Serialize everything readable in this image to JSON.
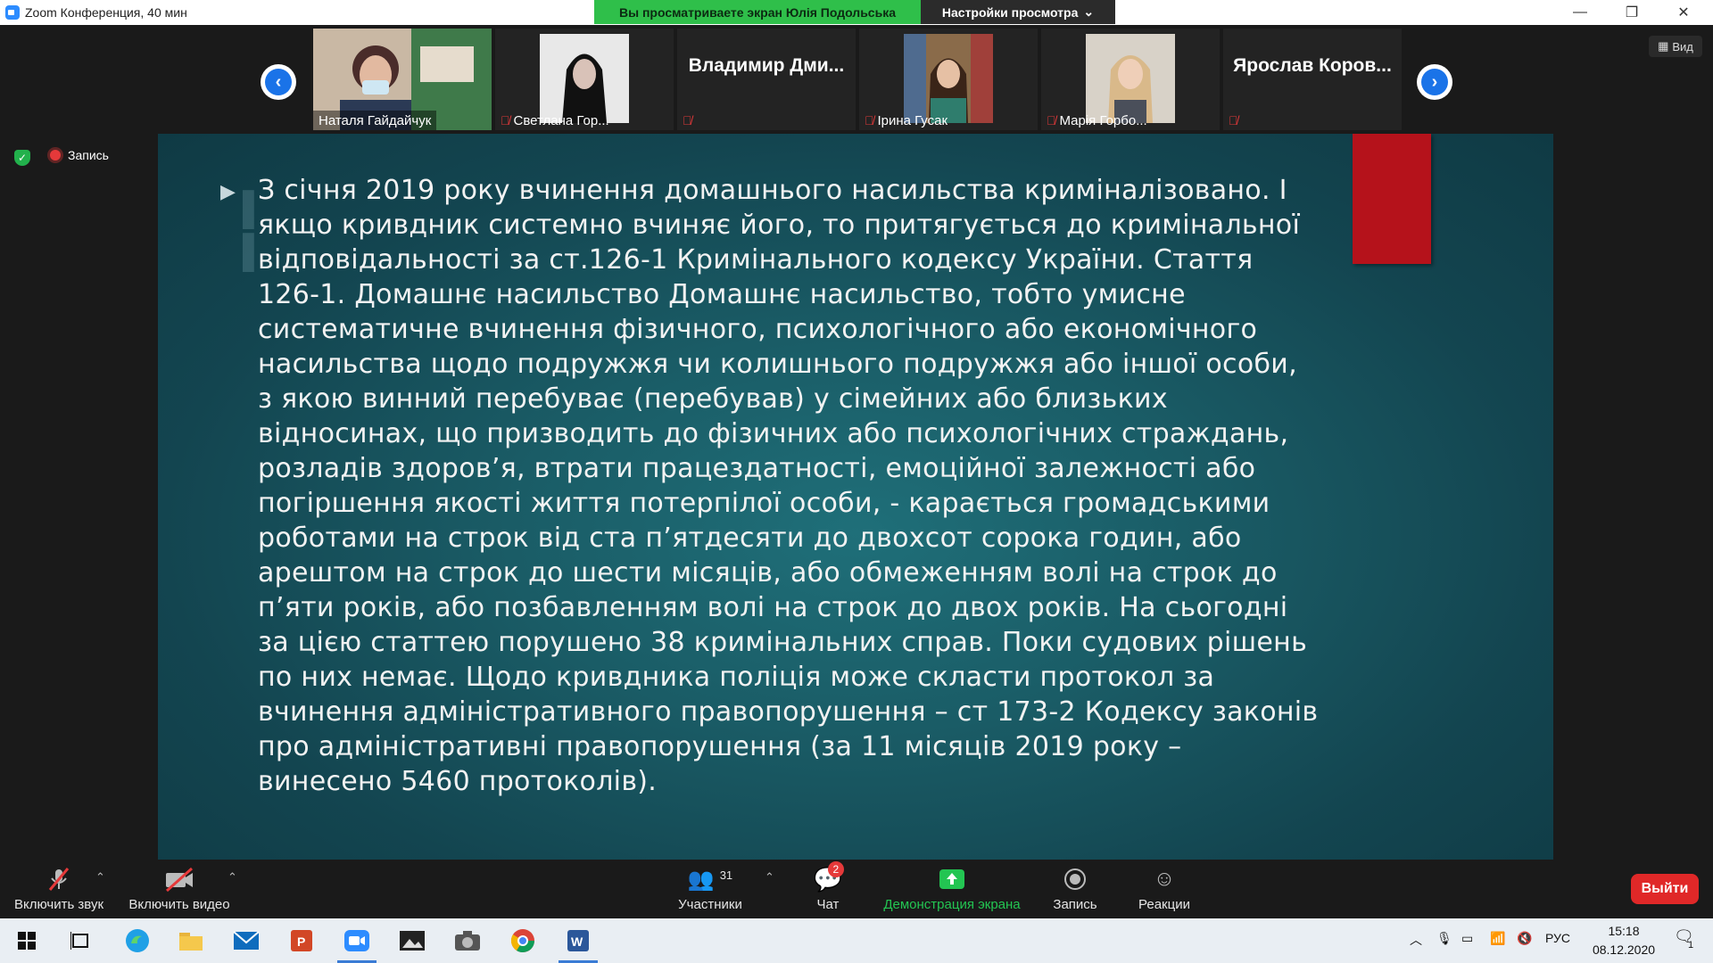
{
  "window": {
    "title": "Zoom Конференция, 40 мин",
    "share_banner": "Вы просматриваете экран Юлія Подольська",
    "view_settings": "Настройки просмотра",
    "minimize": "—",
    "restore": "❐",
    "close": "✕"
  },
  "gallery": {
    "participants": [
      {
        "name": "Наталя Гайдайчук",
        "has_video": true,
        "muted": false
      },
      {
        "name": "Светлана Гор...",
        "has_video": true,
        "muted": true
      },
      {
        "name": "Владимир Дми...",
        "has_video": false,
        "muted": true
      },
      {
        "name": "Ірина Гусак",
        "has_video": true,
        "muted": true
      },
      {
        "name": "Марія Горбо...",
        "has_video": true,
        "muted": true
      },
      {
        "name": "Ярослав Коров...",
        "has_video": false,
        "muted": true
      }
    ],
    "view_label": "Вид"
  },
  "status": {
    "recording_label": "Запись"
  },
  "slide": {
    "text": "З січня 2019 року вчинення домашнього насильства криміналізовано. І якщо кривдник системно вчиняє його, то притягується до кримінальної відповідальності за ст.126-1 Кримінального кодексу України. Стаття 126-1. Домашнє насильство Домашнє насильство, тобто умисне систематичне вчинення фізичного, психологічного або економічного насильства щодо подружжя чи колишнього подружжя або іншої особи, з якою винний перебуває (перебував) у сімейних або близьких відносинах, що призводить до фізичних або психологічних страждань, розладів здоров’я, втрати працездатності, емоційної залежності або погіршення якості життя потерпілої особи, - карається громадськими роботами на строк від ста п’ятдесяти до двохсот сорока годин, або арештом на строк до шести місяців, або обмеженням волі на строк до п’яти років, або позбавленням волі на строк до двох років. На сьогодні за цією статтею порушено 38 кримінальних справ. Поки судових рішень по них немає. Щодо кривдника поліція може скласти протокол за вчинення адміністративного правопорушення – ст 173-2 Кодексу законів про адміністративні правопорушення (за 11 місяців 2019 року – винесено 5460 протоколів).",
    "accent_color": "#b5121b"
  },
  "toolbar": {
    "audio": "Включить звук",
    "video": "Включить видео",
    "participants": "Участники",
    "participants_count": "31",
    "chat": "Чат",
    "chat_badge": "2",
    "share": "Демонстрация экрана",
    "record": "Запись",
    "reactions": "Реакции",
    "leave": "Выйти"
  },
  "taskbar": {
    "language": "РУС",
    "time": "15:18",
    "date": "08.12.2020",
    "notifications": "1"
  }
}
